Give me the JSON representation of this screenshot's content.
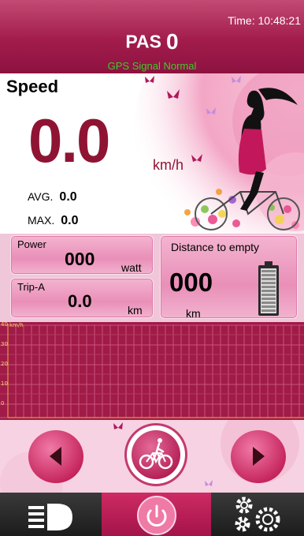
{
  "header": {
    "time": "Time: 10:48:21",
    "pas_label": "PAS",
    "pas_value": "0",
    "gps_status": "GPS Signal Normal"
  },
  "speed": {
    "title": "Speed",
    "value": "0.0",
    "unit": "km/h",
    "avg_label": "AVG.",
    "avg_value": "0.0",
    "max_label": "MAX.",
    "max_value": "0.0"
  },
  "power": {
    "label": "Power",
    "value": "000",
    "unit": "watt"
  },
  "trip": {
    "label": "Trip-A",
    "value": "0.0",
    "unit": "km"
  },
  "range": {
    "label": "Distance to empty",
    "value": "000",
    "unit": "km"
  },
  "graph": {
    "unit": "km/h",
    "y_ticks": [
      "40",
      "30",
      "20",
      "10",
      "0"
    ]
  },
  "nav": {
    "prev_icon": "triangle-left-icon",
    "center_icon": "walk-bike-icon",
    "next_icon": "triangle-right-icon"
  },
  "bottom": {
    "left_icon": "headlight-icon",
    "center_icon": "power-icon",
    "right_icon": "gears-icon"
  },
  "colors": {
    "brand": "#a21c4b",
    "speed_text": "#8f1434",
    "gps_ok": "#3ecb2a",
    "graph_bg": "#a01b47"
  }
}
